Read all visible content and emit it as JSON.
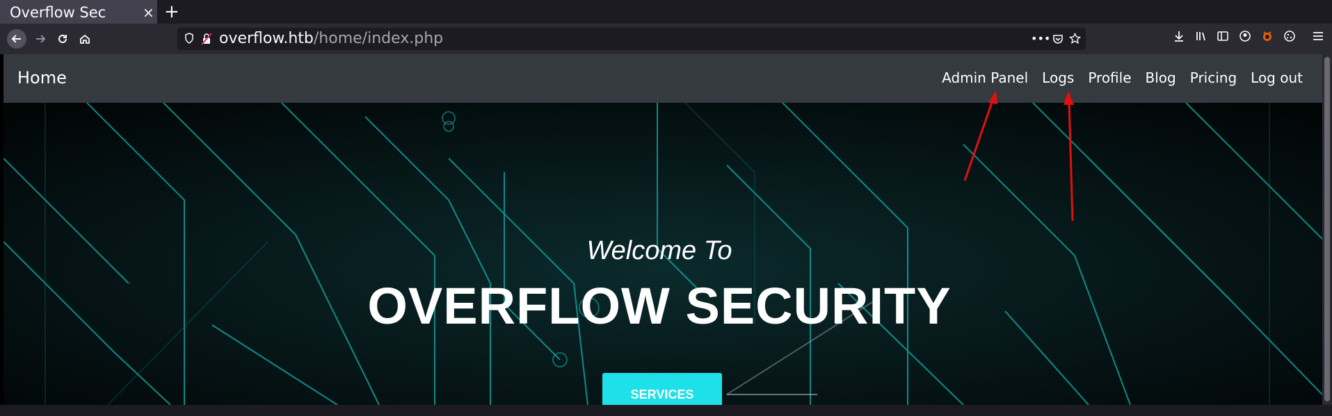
{
  "browser": {
    "tab_title": "Overflow Sec",
    "tab_close": "×",
    "new_tab": "+",
    "url_host": "overflow.htb",
    "url_path": "/home/index.php"
  },
  "site": {
    "brand": "Home",
    "nav": [
      "Admin Panel",
      "Logs",
      "Profile",
      "Blog",
      "Pricing",
      "Log out"
    ],
    "welcome": "Welcome To",
    "headline": "OVERFLOW SECURITY",
    "cta": "SERVICES"
  },
  "colors": {
    "navbar_bg": "#343a40",
    "cta_bg": "#1de0e8",
    "circuit": "#0fb3b3",
    "annotation_arrow": "#e01010"
  },
  "icons": [
    "back-icon",
    "forward-icon",
    "reload-icon",
    "home-icon",
    "shield-icon",
    "lock-icon",
    "more-icon",
    "pocket-icon",
    "bookmark-star-icon",
    "download-icon",
    "library-icon",
    "sidebar-icon",
    "account-icon",
    "extension-icon",
    "cookie-icon",
    "menu-icon"
  ]
}
